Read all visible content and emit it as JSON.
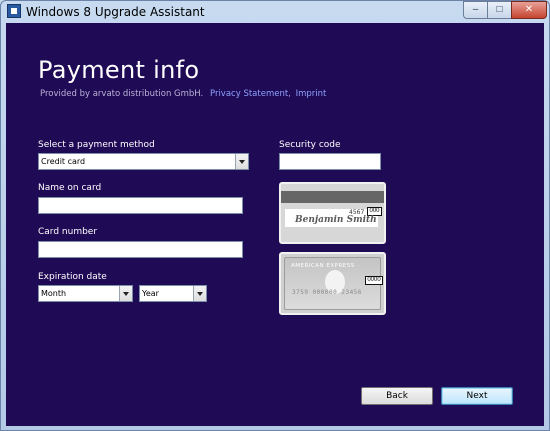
{
  "window": {
    "title": "Windows 8 Upgrade Assistant",
    "controls": {
      "minimize": "–",
      "maximize": "□",
      "close": "✕"
    }
  },
  "page": {
    "heading": "Payment info",
    "provider_text": "Provided by arvato distribution GmbH.",
    "links": [
      "Privacy Statement,",
      "Imprint"
    ]
  },
  "form": {
    "payment_method_label": "Select a payment method",
    "payment_method_value": "Credit card",
    "name_label": "Name on card",
    "name_value": "",
    "card_number_label": "Card number",
    "card_number_value": "",
    "expiration_label": "Expiration date",
    "month_value": "Month",
    "year_value": "Year",
    "security_code_label": "Security code",
    "security_code_value": ""
  },
  "cards": {
    "back": {
      "signature": "Benjamin Smith",
      "number_fragment": "4567",
      "cvv": "000"
    },
    "front": {
      "brand": "AMERICAN EXPRESS",
      "number": "3759 000000 23456",
      "cvv": "0000"
    }
  },
  "buttons": {
    "back": "Back",
    "next": "Next"
  },
  "colors": {
    "background": "#1f0a55",
    "link": "#8fa2ff"
  }
}
